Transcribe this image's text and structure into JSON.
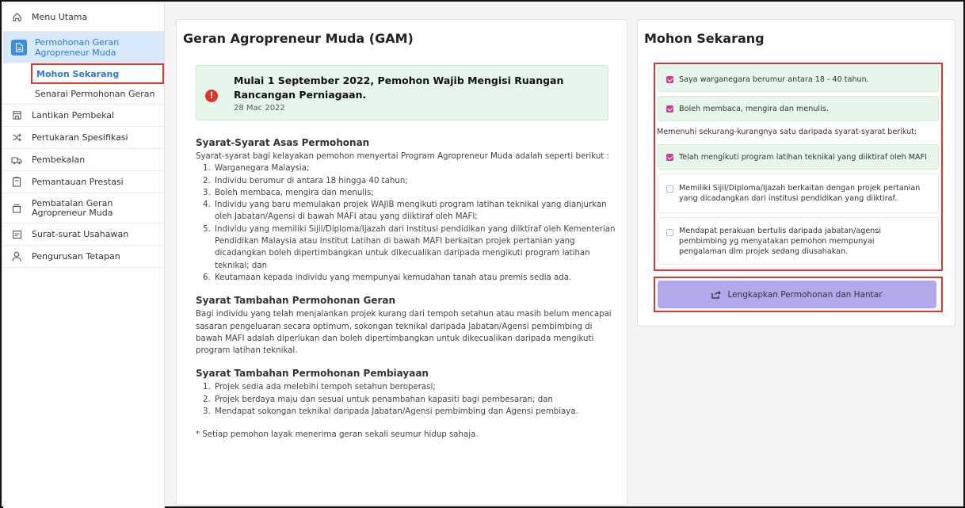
{
  "sidebar": {
    "items": [
      {
        "label": "Menu Utama",
        "icon": "home-icon"
      },
      {
        "label": "Permohonan Geran Agropreneur Muda",
        "icon": "document-icon"
      },
      {
        "label": "Lantikan Pembekal",
        "icon": "store-icon"
      },
      {
        "label": "Pertukaran Spesifikasi",
        "icon": "shuffle-icon"
      },
      {
        "label": "Pembekalan",
        "icon": "truck-icon"
      },
      {
        "label": "Pemantauan Prestasi",
        "icon": "clipboard-icon"
      },
      {
        "label": "Pembatalan Geran Agropreneur Muda",
        "icon": "archive-icon"
      },
      {
        "label": "Surat-surat Usahawan",
        "icon": "mail-icon"
      },
      {
        "label": "Pengurusan Tetapan",
        "icon": "user-icon"
      }
    ],
    "sub_items": [
      {
        "label": "Mohon Sekarang",
        "selected": true
      },
      {
        "label": "Senarai Permohonan Geran",
        "selected": false
      }
    ]
  },
  "main": {
    "title": "Geran Agropreneur Muda (GAM)",
    "alert": {
      "title": "Mulai 1 September 2022, Pemohon Wajib Mengisi Ruangan Rancangan Perniagaan.",
      "date": "28 Mac 2022"
    },
    "sections": [
      {
        "title": "Syarat-Syarat Asas Permohonan",
        "intro": "Syarat-syarat bagi kelayakan pemohon menyertai Program Agropreneur Muda adalah seperti berikut :",
        "items": [
          "Warganegara Malaysia;",
          "Individu berumur di antara 18 hingga 40 tahun;",
          "Boleh membaca, mengira dan menulis;",
          "Individu yang baru memulakan projek WAJIB mengikuti program latihan teknikal yang dianjurkan oleh Jabatan/Agensi di bawah MAFI atau yang diiktiraf oleh MAFI;",
          "Individu yang memiliki Sijil/Diploma/Ijazah dari institusi pendidikan yang diiktiraf oleh Kementerian Pendidikan Malaysia atau Institut Latihan di bawah MAFI berkaitan projek pertanian yang dicadangkan boleh dipertimbangkan untuk dikecualikan daripada mengikuti program latihan teknikal; dan",
          "Keutamaan kepada individu yang mempunyai kemudahan tanah atau premis sedia ada."
        ]
      },
      {
        "title": "Syarat Tambahan Permohonan Geran",
        "intro": "Bagi individu yang telah menjalankan projek kurang dari tempoh setahun atau masih belum mencapai sasaran pengeluaran secara optimum, sokongan teknikal daripada Jabatan/Agensi pembimbing di bawah MAFI adalah diperlukan dan boleh dipertimbangkan untuk dikecualikan daripada mengikuti program latihan teknikal."
      },
      {
        "title": "Syarat Tambahan Permohonan Pembiayaan",
        "items": [
          "Projek sedia ada melebihi tempoh setahun beroperasi;",
          "Projek berdaya maju dan sesuai untuk penambahan kapasiti bagi pembesaran; dan",
          "Mendapat sokongan teknikal daripada Jabatan/Agensi pembimbing dan Agensi pembiaya."
        ]
      }
    ],
    "footnote": "* Setiap pemohon layak menerima geran sekali seumur hidup sahaja."
  },
  "apply": {
    "title": "Mohon Sekarang",
    "checks": [
      {
        "label": "Saya warganegara berumur antara 18 - 40 tahun.",
        "checked": true
      },
      {
        "label": "Boleh membaca, mengira dan menulis.",
        "checked": true
      }
    ],
    "subheading": "Memenuhi sekurang-kurangnya satu daripada syarat-syarat berikut:",
    "options": [
      {
        "label": "Telah mengikuti program latihan teknikal yang diiktiraf oleh MAFI",
        "checked": true
      },
      {
        "label": "Memiliki Sijil/Diploma/Ijazah berkaitan dengan projek pertanian yang dicadangkan dari institusi pendidikan yang diiktiraf.",
        "checked": false
      },
      {
        "label": "Mendapat perakuan bertulis daripada jabatan/agensi pembimbing yg menyatakan pemohon mempunyai pengalaman dlm projek sedang diusahakan.",
        "checked": false
      }
    ],
    "submit_label": "Lengkapkan Permohonan dan Hantar",
    "submit_icon": "share-icon"
  },
  "colors": {
    "accent_blue": "#2a7bd0",
    "highlight_red": "#e0352b",
    "checkbox_pink": "#d43d8f",
    "submit_purple": "#b2a9ec",
    "alert_green": "#e6f6ea"
  }
}
